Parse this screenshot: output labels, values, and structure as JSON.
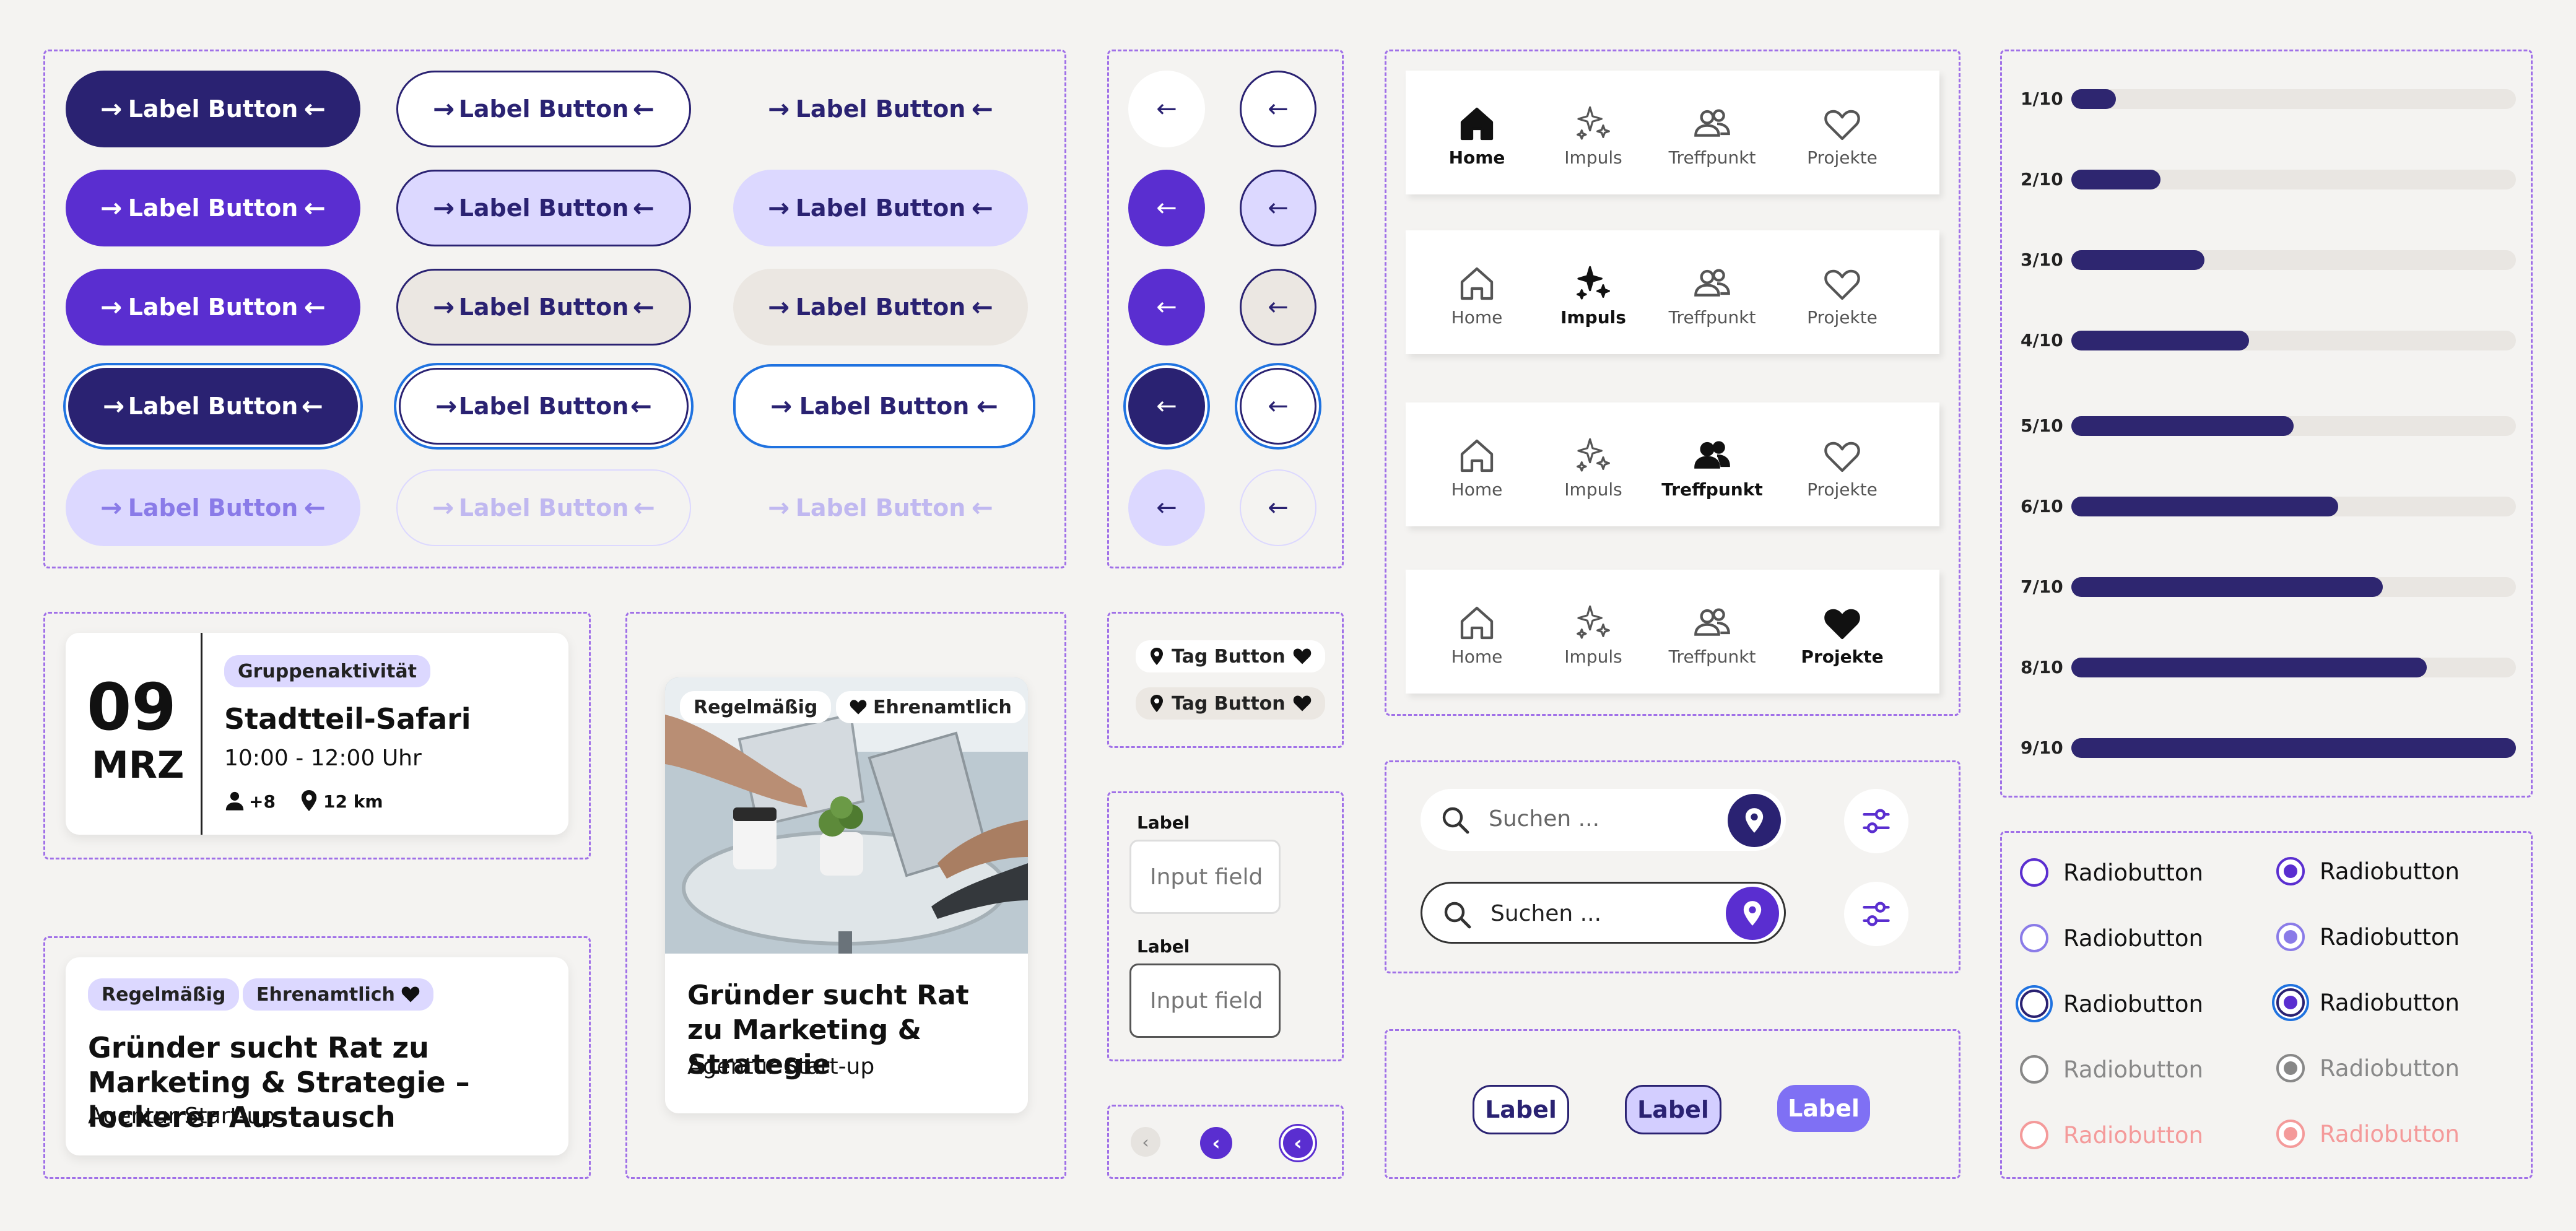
{
  "buttons": {
    "label": "Label Button"
  },
  "circle_buttons": {
    "arrow": "←"
  },
  "nav": {
    "items": [
      "Home",
      "Impuls",
      "Treffpunkt",
      "Projekte"
    ]
  },
  "progress": [
    {
      "label": "1/10",
      "value": 0.1
    },
    {
      "label": "2/10",
      "value": 0.2
    },
    {
      "label": "3/10",
      "value": 0.3
    },
    {
      "label": "4/10",
      "value": 0.4
    },
    {
      "label": "5/10",
      "value": 0.5
    },
    {
      "label": "6/10",
      "value": 0.6
    },
    {
      "label": "7/10",
      "value": 0.7
    },
    {
      "label": "8/10",
      "value": 0.8
    },
    {
      "label": "9/10",
      "value": 1.0
    }
  ],
  "event_card": {
    "day": "09",
    "month": "MRZ",
    "category": "Gruppenaktivität",
    "title": "Stadtteil-Safari",
    "time": "10:00 - 12:00 Uhr",
    "participants": "+8",
    "distance": "12 km"
  },
  "text_card": {
    "tag1": "Regelmäßig",
    "tag2": "Ehrenamtlich",
    "title": "Gründer sucht Rat zu Marketing & Strategie – lockerer Austausch",
    "subtitle": "Agentur Start-up"
  },
  "image_card": {
    "tag1": "Regelmäßig",
    "tag2": "Ehrenamtlich",
    "title": "Gründer sucht Rat zu Marketing & Strategie",
    "subtitle": "Agentur Start-up"
  },
  "tag_button": {
    "label": "Tag Button"
  },
  "inputs": {
    "label": "Label",
    "placeholder": "Input field"
  },
  "search": {
    "placeholder": "Suchen ..."
  },
  "chips": {
    "label": "Label"
  },
  "radios": {
    "label": "Radiobutton"
  },
  "colors": {
    "primary": "#5a2ed0",
    "dark": "#2a2272",
    "light": "#dcd8ff",
    "beige": "#ebe7e2",
    "focus": "#1f72e0",
    "disabled": "#c8b8f8",
    "error": "#f49a9a"
  }
}
